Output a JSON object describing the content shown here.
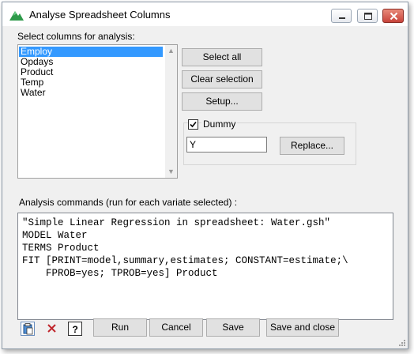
{
  "window": {
    "title": "Analyse Spreadsheet Columns",
    "icon": "app-triangle-icon"
  },
  "columns": {
    "label": "Select columns for analysis:",
    "items": [
      {
        "label": "Employ",
        "selected": true
      },
      {
        "label": "Opdays",
        "selected": false
      },
      {
        "label": "Product",
        "selected": false
      },
      {
        "label": "Temp",
        "selected": false
      },
      {
        "label": "Water",
        "selected": false
      }
    ]
  },
  "buttons": {
    "select_all": "Select all",
    "clear_selection": "Clear selection",
    "setup": "Setup...",
    "replace": "Replace...",
    "run": "Run",
    "cancel": "Cancel",
    "save": "Save",
    "save_and_close": "Save and close"
  },
  "dummy": {
    "label": "Dummy",
    "checked": true,
    "value": "Y"
  },
  "commands": {
    "label": "Analysis commands (run for each variate selected) :",
    "text": "\"Simple Linear Regression in spreadsheet: Water.gsh\"\nMODEL Water\nTERMS Product\nFIT [PRINT=model,summary,estimates; CONSTANT=estimate;\\\n    FPROB=yes; TPROB=yes] Product"
  },
  "toolbar": {
    "icons": [
      "paste-icon",
      "clear-icon",
      "help-icon"
    ]
  }
}
